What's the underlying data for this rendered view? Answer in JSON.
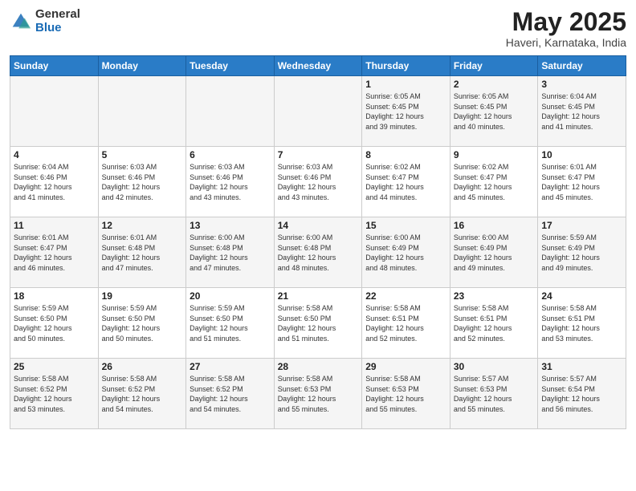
{
  "header": {
    "logo_general": "General",
    "logo_blue": "Blue",
    "month_title": "May 2025",
    "location": "Haveri, Karnataka, India"
  },
  "days_of_week": [
    "Sunday",
    "Monday",
    "Tuesday",
    "Wednesday",
    "Thursday",
    "Friday",
    "Saturday"
  ],
  "weeks": [
    [
      {
        "day": "",
        "info": ""
      },
      {
        "day": "",
        "info": ""
      },
      {
        "day": "",
        "info": ""
      },
      {
        "day": "",
        "info": ""
      },
      {
        "day": "1",
        "info": "Sunrise: 6:05 AM\nSunset: 6:45 PM\nDaylight: 12 hours\nand 39 minutes."
      },
      {
        "day": "2",
        "info": "Sunrise: 6:05 AM\nSunset: 6:45 PM\nDaylight: 12 hours\nand 40 minutes."
      },
      {
        "day": "3",
        "info": "Sunrise: 6:04 AM\nSunset: 6:45 PM\nDaylight: 12 hours\nand 41 minutes."
      }
    ],
    [
      {
        "day": "4",
        "info": "Sunrise: 6:04 AM\nSunset: 6:46 PM\nDaylight: 12 hours\nand 41 minutes."
      },
      {
        "day": "5",
        "info": "Sunrise: 6:03 AM\nSunset: 6:46 PM\nDaylight: 12 hours\nand 42 minutes."
      },
      {
        "day": "6",
        "info": "Sunrise: 6:03 AM\nSunset: 6:46 PM\nDaylight: 12 hours\nand 43 minutes."
      },
      {
        "day": "7",
        "info": "Sunrise: 6:03 AM\nSunset: 6:46 PM\nDaylight: 12 hours\nand 43 minutes."
      },
      {
        "day": "8",
        "info": "Sunrise: 6:02 AM\nSunset: 6:47 PM\nDaylight: 12 hours\nand 44 minutes."
      },
      {
        "day": "9",
        "info": "Sunrise: 6:02 AM\nSunset: 6:47 PM\nDaylight: 12 hours\nand 45 minutes."
      },
      {
        "day": "10",
        "info": "Sunrise: 6:01 AM\nSunset: 6:47 PM\nDaylight: 12 hours\nand 45 minutes."
      }
    ],
    [
      {
        "day": "11",
        "info": "Sunrise: 6:01 AM\nSunset: 6:47 PM\nDaylight: 12 hours\nand 46 minutes."
      },
      {
        "day": "12",
        "info": "Sunrise: 6:01 AM\nSunset: 6:48 PM\nDaylight: 12 hours\nand 47 minutes."
      },
      {
        "day": "13",
        "info": "Sunrise: 6:00 AM\nSunset: 6:48 PM\nDaylight: 12 hours\nand 47 minutes."
      },
      {
        "day": "14",
        "info": "Sunrise: 6:00 AM\nSunset: 6:48 PM\nDaylight: 12 hours\nand 48 minutes."
      },
      {
        "day": "15",
        "info": "Sunrise: 6:00 AM\nSunset: 6:49 PM\nDaylight: 12 hours\nand 48 minutes."
      },
      {
        "day": "16",
        "info": "Sunrise: 6:00 AM\nSunset: 6:49 PM\nDaylight: 12 hours\nand 49 minutes."
      },
      {
        "day": "17",
        "info": "Sunrise: 5:59 AM\nSunset: 6:49 PM\nDaylight: 12 hours\nand 49 minutes."
      }
    ],
    [
      {
        "day": "18",
        "info": "Sunrise: 5:59 AM\nSunset: 6:50 PM\nDaylight: 12 hours\nand 50 minutes."
      },
      {
        "day": "19",
        "info": "Sunrise: 5:59 AM\nSunset: 6:50 PM\nDaylight: 12 hours\nand 50 minutes."
      },
      {
        "day": "20",
        "info": "Sunrise: 5:59 AM\nSunset: 6:50 PM\nDaylight: 12 hours\nand 51 minutes."
      },
      {
        "day": "21",
        "info": "Sunrise: 5:58 AM\nSunset: 6:50 PM\nDaylight: 12 hours\nand 51 minutes."
      },
      {
        "day": "22",
        "info": "Sunrise: 5:58 AM\nSunset: 6:51 PM\nDaylight: 12 hours\nand 52 minutes."
      },
      {
        "day": "23",
        "info": "Sunrise: 5:58 AM\nSunset: 6:51 PM\nDaylight: 12 hours\nand 52 minutes."
      },
      {
        "day": "24",
        "info": "Sunrise: 5:58 AM\nSunset: 6:51 PM\nDaylight: 12 hours\nand 53 minutes."
      }
    ],
    [
      {
        "day": "25",
        "info": "Sunrise: 5:58 AM\nSunset: 6:52 PM\nDaylight: 12 hours\nand 53 minutes."
      },
      {
        "day": "26",
        "info": "Sunrise: 5:58 AM\nSunset: 6:52 PM\nDaylight: 12 hours\nand 54 minutes."
      },
      {
        "day": "27",
        "info": "Sunrise: 5:58 AM\nSunset: 6:52 PM\nDaylight: 12 hours\nand 54 minutes."
      },
      {
        "day": "28",
        "info": "Sunrise: 5:58 AM\nSunset: 6:53 PM\nDaylight: 12 hours\nand 55 minutes."
      },
      {
        "day": "29",
        "info": "Sunrise: 5:58 AM\nSunset: 6:53 PM\nDaylight: 12 hours\nand 55 minutes."
      },
      {
        "day": "30",
        "info": "Sunrise: 5:57 AM\nSunset: 6:53 PM\nDaylight: 12 hours\nand 55 minutes."
      },
      {
        "day": "31",
        "info": "Sunrise: 5:57 AM\nSunset: 6:54 PM\nDaylight: 12 hours\nand 56 minutes."
      }
    ]
  ]
}
